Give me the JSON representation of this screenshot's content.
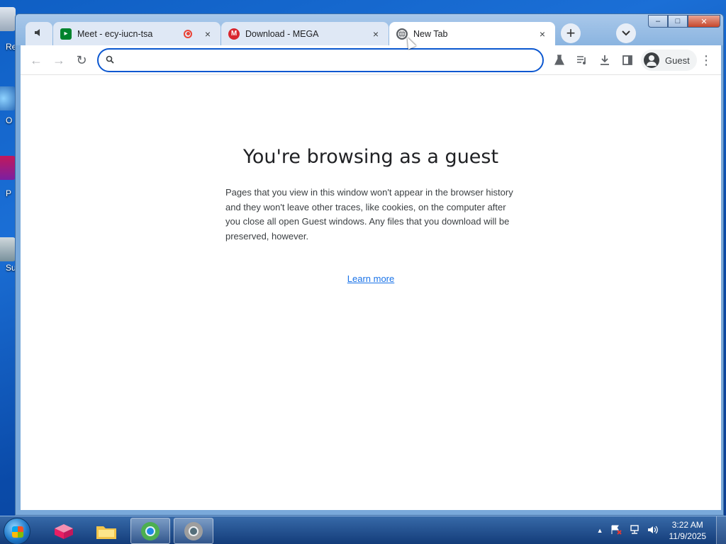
{
  "desktop": {
    "labels": [
      "Re",
      "O",
      "P",
      "Su"
    ]
  },
  "browser": {
    "tabs": [
      {
        "kind": "audio",
        "icon": "speaker-icon"
      },
      {
        "title": "Meet - ecy-iucn-tsa",
        "icon": "google-meet-icon",
        "recording": true,
        "close": "×"
      },
      {
        "title": "Download - MEGA",
        "icon": "mega-icon",
        "close": "×"
      },
      {
        "title": "New Tab",
        "icon": "globe-icon",
        "active": true,
        "close": "×"
      }
    ],
    "new_tab_symbol": "+",
    "window_controls": {
      "minimize": "–",
      "maximize": "□",
      "close": "✕"
    },
    "toolbar": {
      "back": "←",
      "forward": "→",
      "reload": "↻",
      "omnibox_value": "",
      "profile_label": "Guest",
      "menu": "⋮"
    }
  },
  "page": {
    "title": "You're browsing as a guest",
    "description": "Pages that you view in this window won't appear in the browser history and they won't leave other traces, like cookies, on the computer after you close all open Guest windows. Any files that you download will be preserved, however.",
    "learn_more": "Learn more"
  },
  "taskbar": {
    "time": "3:22 AM",
    "date": "11/9/2025",
    "tray_arrow": "▲"
  },
  "colors": {
    "accent": "#0b57d0",
    "link": "#1a73e8",
    "meet_red": "#ea4335",
    "mega_red": "#d9272e"
  }
}
